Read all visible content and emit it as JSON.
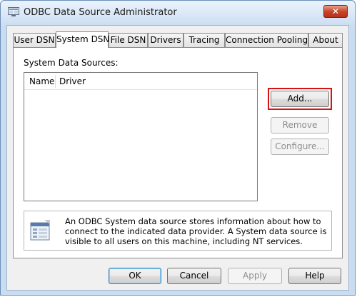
{
  "window": {
    "title": "ODBC Data Source Administrator",
    "close_label": "✕"
  },
  "tabs": [
    {
      "label": "User DSN",
      "active": false
    },
    {
      "label": "System DSN",
      "active": true
    },
    {
      "label": "File DSN",
      "active": false
    },
    {
      "label": "Drivers",
      "active": false
    },
    {
      "label": "Tracing",
      "active": false
    },
    {
      "label": "Connection Pooling",
      "active": false
    },
    {
      "label": "About",
      "active": false
    }
  ],
  "system_dsn": {
    "section_label": "System Data Sources:",
    "columns": [
      "Name",
      "Driver"
    ],
    "rows": [],
    "buttons": {
      "add": "Add...",
      "remove": "Remove",
      "configure": "Configure..."
    },
    "info_text": "An ODBC System data source stores information about how to connect to the indicated data provider.   A System data source is visible to all users on this machine, including NT services."
  },
  "footer": {
    "ok": "OK",
    "cancel": "Cancel",
    "apply": "Apply",
    "help": "Help"
  },
  "colors": {
    "highlight": "#d41414",
    "close": "#c9442a"
  }
}
